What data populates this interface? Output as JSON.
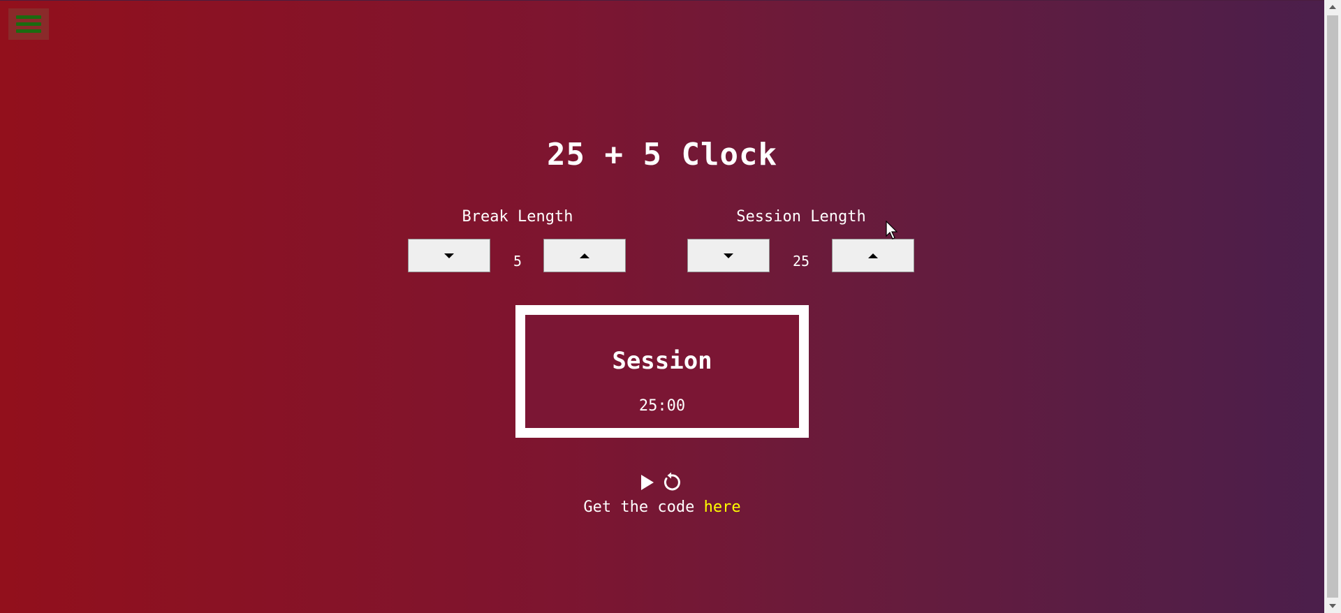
{
  "app": {
    "title": "25 + 5 Clock"
  },
  "break": {
    "label": "Break Length",
    "value": "5"
  },
  "session": {
    "label": "Session Length",
    "value": "25"
  },
  "timer": {
    "label": "Session",
    "time": "25:00"
  },
  "footer": {
    "text": "Get the code ",
    "link_text": "here"
  },
  "colors": {
    "accent_link": "#ffff00",
    "menu_bar": "#1b6b10"
  },
  "icons": {
    "menu": "hamburger-icon",
    "decrement": "arrow-down-icon",
    "increment": "arrow-up-icon",
    "play": "play-icon",
    "reset": "reset-icon"
  }
}
